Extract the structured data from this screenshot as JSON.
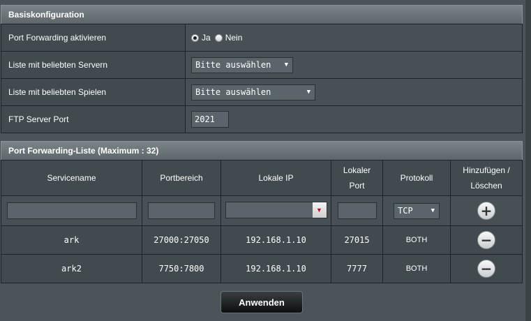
{
  "basic": {
    "title": "Basiskonfiguration",
    "rows": {
      "enable_label": "Port Forwarding aktivieren",
      "enable_yes": "Ja",
      "enable_no": "Nein",
      "servers_label": "Liste mit beliebten Servern",
      "servers_value": "Bitte auswählen",
      "games_label": "Liste mit beliebten Spielen",
      "games_value": "Bitte auswählen",
      "ftp_label": "FTP Server Port",
      "ftp_value": "2021"
    }
  },
  "list": {
    "title": "Port Forwarding-Liste (Maximum : 32)",
    "headers": {
      "service": "Servicename",
      "range": "Portbereich",
      "local_ip": "Lokale IP",
      "local_port_line1": "Lokaler",
      "local_port_line2": "Port",
      "protocol": "Protokoll",
      "action_line1": "Hinzufügen /",
      "action_line2": "Löschen"
    },
    "input_row": {
      "protocol_value": "TCP"
    },
    "rows": [
      {
        "name": "ark",
        "range": "27000:27050",
        "ip": "192.168.1.10",
        "port": "27015",
        "protocol": "BOTH"
      },
      {
        "name": "ark2",
        "range": "7750:7800",
        "ip": "192.168.1.10",
        "port": "7777",
        "protocol": "BOTH"
      }
    ]
  },
  "apply_label": "Anwenden",
  "icons": {
    "add": "add-circle-icon",
    "delete": "remove-circle-icon",
    "dropdown": "triangle-down-icon"
  }
}
